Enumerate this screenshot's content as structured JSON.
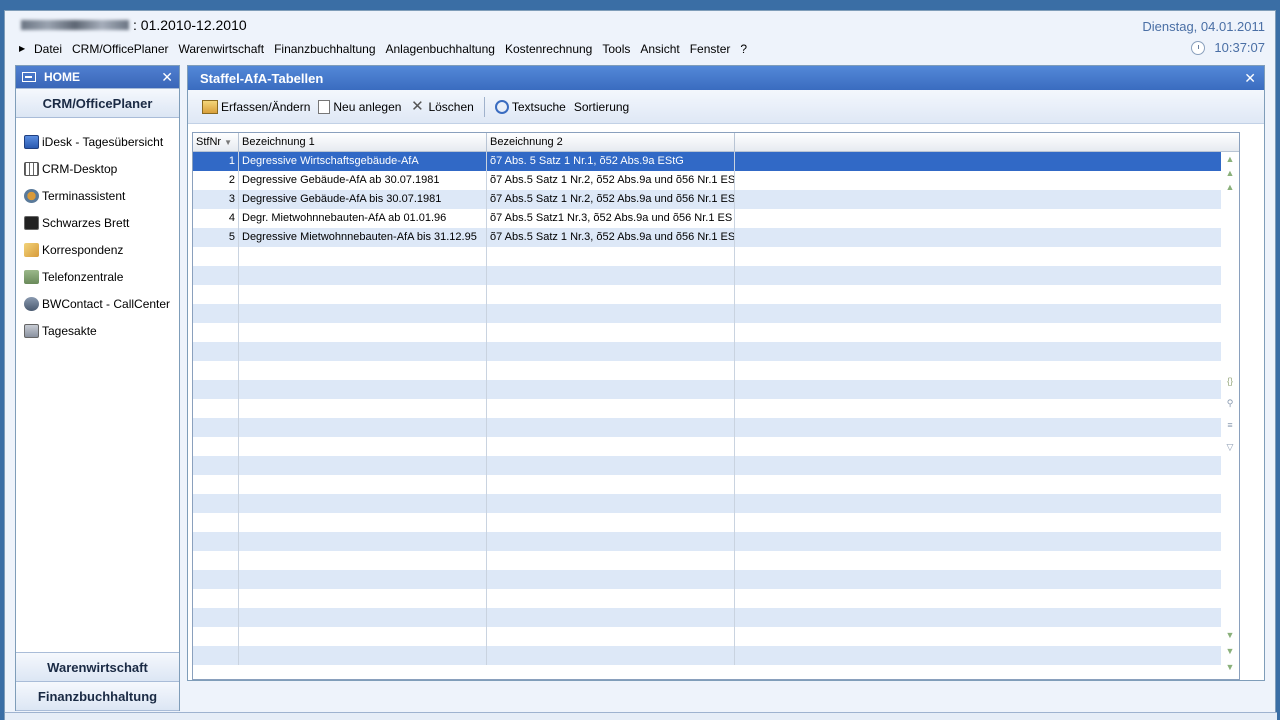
{
  "header": {
    "title_suffix": ": 01.2010-12.2010",
    "date": "Dienstag, 04.01.2011",
    "time": "10:37:07"
  },
  "menu": [
    "Datei",
    "CRM/OfficePlaner",
    "Warenwirtschaft",
    "Finanzbuchhaltung",
    "Anlagenbuchhaltung",
    "Kostenrechnung",
    "Tools",
    "Ansicht",
    "Fenster",
    "?"
  ],
  "nav": {
    "home_label": "HOME",
    "section": "CRM/OfficePlaner",
    "items": [
      {
        "label": "iDesk - Tagesübersicht",
        "icon": "monitor-icon"
      },
      {
        "label": "CRM-Desktop",
        "icon": "grid-icon"
      },
      {
        "label": "Terminassistent",
        "icon": "wizard-icon"
      },
      {
        "label": "Schwarzes Brett",
        "icon": "board-icon"
      },
      {
        "label": "Korrespondenz",
        "icon": "letter-icon"
      },
      {
        "label": "Telefonzentrale",
        "icon": "phone-icon"
      },
      {
        "label": "BWContact - CallCenter",
        "icon": "headset-icon"
      },
      {
        "label": "Tagesakte",
        "icon": "folder-icon"
      }
    ],
    "bottom_sections": [
      "Warenwirtschaft",
      "Finanzbuchhaltung"
    ]
  },
  "panel": {
    "title": "Staffel-AfA-Tabellen",
    "toolbar": {
      "edit": "Erfassen/Ändern",
      "new": "Neu anlegen",
      "delete": "Löschen",
      "search": "Textsuche",
      "sort": "Sortierung"
    },
    "columns": [
      "StfNr",
      "Bezeichnung 1",
      "Bezeichnung 2"
    ],
    "rows": [
      {
        "nr": "1",
        "b1": "Degressive Wirtschaftsgebäude-AfA",
        "b2": "õ7 Abs. 5 Satz 1 Nr.1, õ52 Abs.9a EStG"
      },
      {
        "nr": "2",
        "b1": "Degressive Gebäude-AfA ab 30.07.1981",
        "b2": "õ7 Abs.5 Satz 1 Nr.2, õ52 Abs.9a und õ56 Nr.1 ES"
      },
      {
        "nr": "3",
        "b1": "Degressive Gebäude-AfA bis 30.07.1981",
        "b2": "õ7 Abs.5 Satz 1 Nr.2, õ52 Abs.9a und õ56 Nr.1 ES"
      },
      {
        "nr": "4",
        "b1": "Degr. Mietwohnnebauten-AfA ab 01.01.96",
        "b2": "õ7 Abs.5 Satz1 Nr.3, õ52 Abs.9a und õ56 Nr.1 ES"
      },
      {
        "nr": "5",
        "b1": "Degressive Mietwohnnebauten-AfA bis 31.12.95",
        "b2": "õ7 Abs.5 Satz 1 Nr.3, õ52 Abs.9a und õ56 Nr.1 ES"
      }
    ]
  },
  "colors": {
    "accent": "#3a6cc0",
    "selection": "#3169c6",
    "alt_row": "#dde8f7"
  }
}
